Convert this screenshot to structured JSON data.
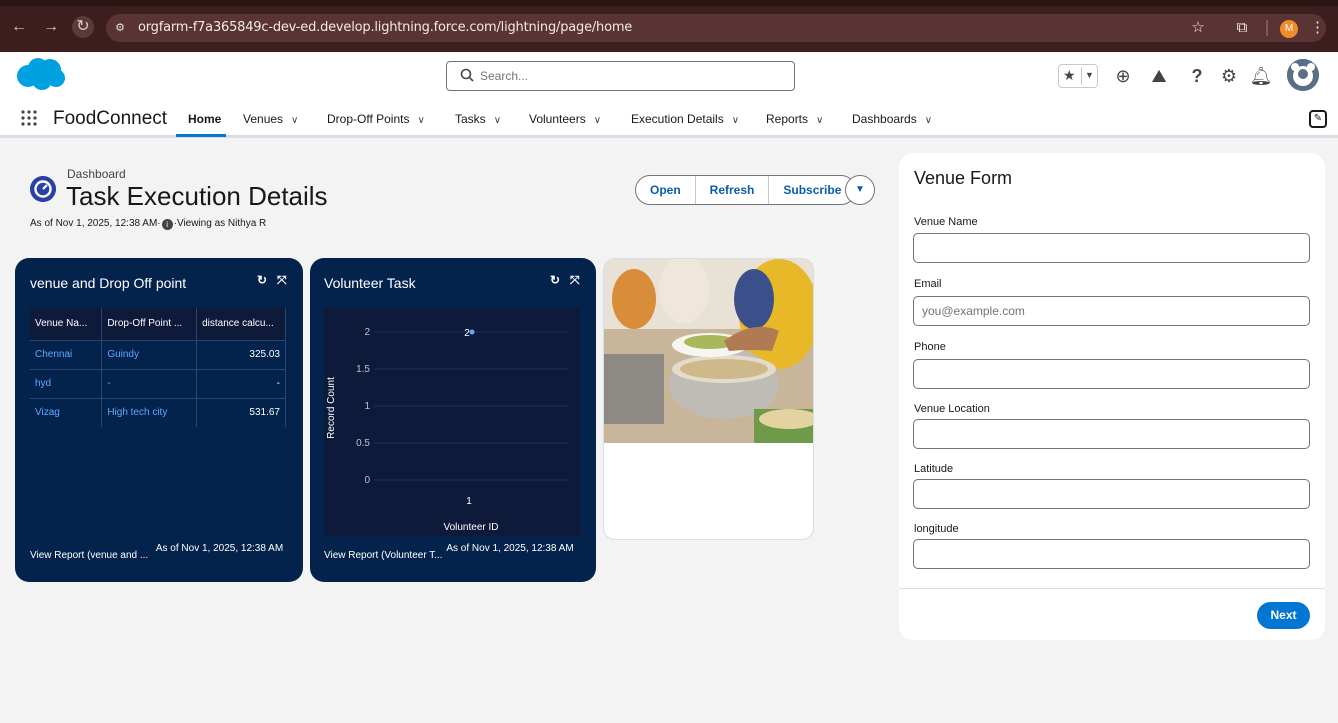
{
  "browser": {
    "url": "orgfarm-f7a365849c-dev-ed.develop.lightning.force.com/lightning/page/home",
    "profile_initial": "M"
  },
  "header": {
    "search_placeholder": "Search..."
  },
  "nav": {
    "app_name": "FoodConnect",
    "items": [
      {
        "label": "Home"
      },
      {
        "label": "Venues"
      },
      {
        "label": "Drop-Off Points"
      },
      {
        "label": "Tasks"
      },
      {
        "label": "Volunteers"
      },
      {
        "label": "Execution Details"
      },
      {
        "label": "Reports"
      },
      {
        "label": "Dashboards"
      }
    ]
  },
  "dashboard": {
    "label": "Dashboard",
    "title": "Task Execution Details",
    "meta_prefix": "As of Nov 1, 2025, 12:38 AM·",
    "meta_suffix": "·Viewing as Nithya R",
    "buttons": {
      "open": "Open",
      "refresh": "Refresh",
      "subscribe": "Subscribe"
    }
  },
  "widget1": {
    "title": "venue and Drop Off point",
    "columns": [
      "Venue Na...",
      "Drop-Off Point ...",
      "distance calcu..."
    ],
    "rows": [
      [
        "Chennai",
        "Guindy",
        "325.03"
      ],
      [
        "hyd",
        "-",
        "-"
      ],
      [
        "Vizag",
        "High tech city",
        "531.67"
      ]
    ],
    "footer_link": "View Report (venue and ...",
    "footer_time": "As of Nov 1, 2025, 12:38 AM"
  },
  "widget2": {
    "title": "Volunteer Task",
    "footer_link": "View Report (Volunteer T...",
    "footer_time": "As of Nov 1, 2025, 12:38 AM"
  },
  "chart_data": {
    "type": "scatter",
    "title": "",
    "xlabel": "Volunteer ID",
    "ylabel": "Record Count",
    "ylim": [
      0,
      2
    ],
    "yticks": [
      "2",
      "1.5",
      "1",
      "0.5",
      "0"
    ],
    "categories": [
      "1"
    ],
    "values": [
      2
    ],
    "data_labels": [
      "2"
    ],
    "grid": true,
    "point_color": "#5ea8ff"
  },
  "form": {
    "title": "Venue Form",
    "fields": [
      {
        "label": "Venue Name",
        "value": "",
        "placeholder": ""
      },
      {
        "label": "Email",
        "value": "",
        "placeholder": "you@example.com"
      },
      {
        "label": "Phone",
        "value": "",
        "placeholder": ""
      },
      {
        "label": "Venue Location",
        "value": "",
        "placeholder": ""
      },
      {
        "label": "Latitude",
        "value": "",
        "placeholder": ""
      },
      {
        "label": "longitude",
        "value": "",
        "placeholder": ""
      }
    ],
    "next_label": "Next"
  },
  "colors": {
    "brand": "#0176d3",
    "widget_bg": "#03234d",
    "link": "#0b5cab"
  }
}
